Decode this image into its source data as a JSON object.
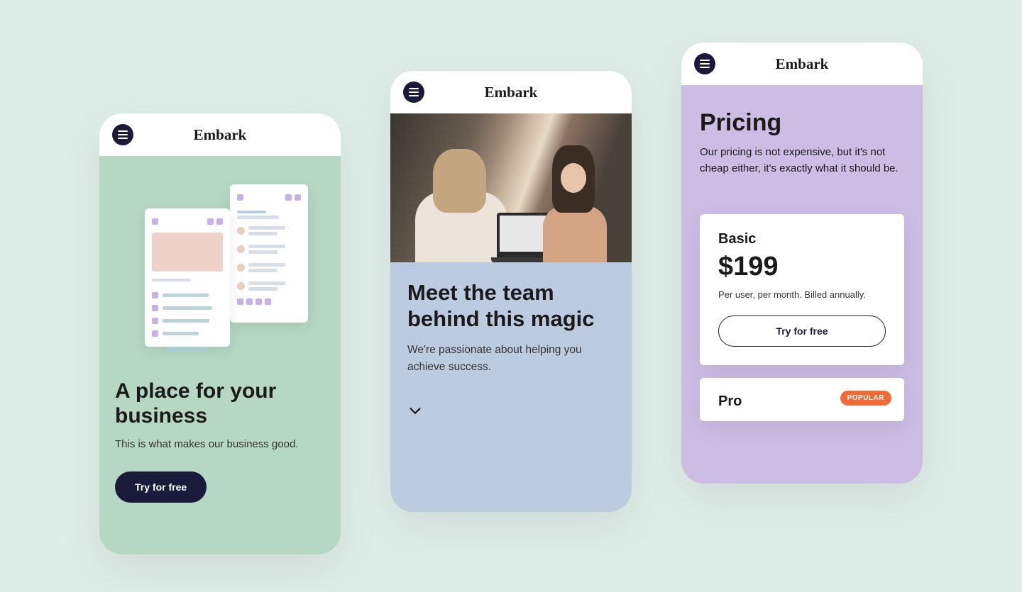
{
  "brand": "Embark",
  "phone1": {
    "headline": "A place for your business",
    "subhead": "This is what makes our business good.",
    "cta": "Try for free"
  },
  "phone2": {
    "headline": "Meet the team behind this magic",
    "subhead": "We're passionate about helping you achieve success."
  },
  "phone3": {
    "title": "Pricing",
    "subhead": "Our pricing is not expensive, but it's not cheap either, it's exactly what it should be.",
    "plans": [
      {
        "name": "Basic",
        "price": "$199",
        "note": "Per user, per month. Billed annually.",
        "cta": "Try for free"
      },
      {
        "name": "Pro",
        "badge": "POPULAR"
      }
    ]
  }
}
